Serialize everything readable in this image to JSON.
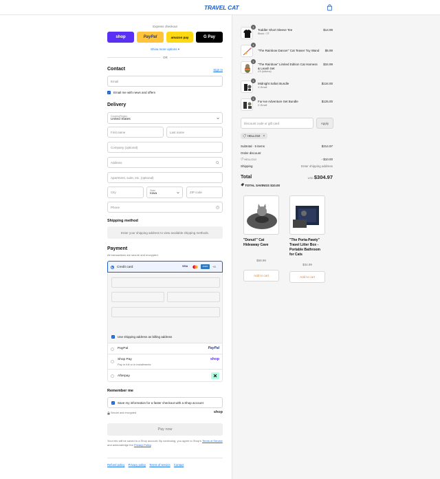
{
  "header": {
    "logo": "TRAVEL CAT"
  },
  "express": {
    "title": "Express checkout",
    "buttons": [
      {
        "label": "shop",
        "bg": "#5a31f4",
        "color": "#ffffff"
      },
      {
        "label": "PayPal",
        "bg": "#ffc439",
        "color": "#253b80"
      },
      {
        "label": "amazon pay",
        "bg": "#ffd814",
        "color": "#111111"
      },
      {
        "label": "G Pay",
        "bg": "#000000",
        "color": "#ffffff"
      }
    ],
    "more_options": "Show more options ▾",
    "or": "OR"
  },
  "contact": {
    "title": "Contact",
    "sign_in": "Sign in",
    "email_placeholder": "Email",
    "news_label": "Email me with news and offers"
  },
  "delivery": {
    "title": "Delivery",
    "country_label": "Country/Region",
    "country_value": "United States",
    "first_name": "First name",
    "last_name": "Last name",
    "company": "Company (optional)",
    "address": "Address",
    "apartment": "Apartment, suite, etc. (optional)",
    "city": "City",
    "state_label": "State",
    "state_value": "Iowa",
    "zip": "ZIP code",
    "phone": "Phone"
  },
  "shipping": {
    "title": "Shipping method",
    "message": "Enter your shipping address to view available shipping methods."
  },
  "payment": {
    "title": "Payment",
    "subtitle": "All transactions are secure and encrypted.",
    "credit_card": "Credit card",
    "card_brands": [
      "VISA",
      "MC",
      "AMEX",
      "+3"
    ],
    "billing_label": "Use shipping address as billing address",
    "paypal": "PayPal",
    "paypal_logo": "PayPal",
    "shop_pay": "Shop Pay",
    "shop_pay_sub": "Pay in full or in installments",
    "shop_logo": "shop",
    "afterpay": "Afterpay"
  },
  "remember": {
    "title": "Remember me",
    "label": "Save my information for a faster checkout with a Shop account",
    "secure": "Secure and encrypted",
    "shop_logo": "shop"
  },
  "pay_now": "Pay now",
  "legal": {
    "text": "Your info will be saved to a Shop account. By continuing, you agree to Shop's",
    "terms": "Terms of Service",
    "and": "and acknowledge the",
    "privacy": "Privacy Policy",
    "end": "."
  },
  "footer_links": [
    "Refund policy",
    "Privacy policy",
    "Terms of service",
    "Contact"
  ],
  "order": {
    "items": [
      {
        "name": "Toddler Short Sleeve Tee",
        "variant": "Black / 2T",
        "price": "$14.99",
        "qty": "1"
      },
      {
        "name": "\"The Rainbow Dancer\" Cat Teaser Toy Wand",
        "variant": "",
        "price": "$5.99",
        "qty": "1"
      },
      {
        "name": "\"The Rainbow\" Limited Edition Cat Harness & Leash Set",
        "variant": "XS (kittens)",
        "price": "$34.99",
        "qty": "1"
      },
      {
        "name": "Midnight Safari Bundle",
        "variant": "X-Small",
        "price": "$134.00",
        "qty": "1"
      },
      {
        "name": "Fur-ive Adventure Set Bundle",
        "variant": "X-Small",
        "price": "$125.00",
        "qty": "1"
      }
    ],
    "discount_placeholder": "Discount code or gift card",
    "apply": "Apply",
    "code_tag": "HELLO10",
    "subtotal_label": "Subtotal · 5 items",
    "subtotal": "$314.97",
    "order_discount_label": "Order discount",
    "discount_code": "HELLO10",
    "discount_value": "- $10.00",
    "shipping_label": "Shipping",
    "shipping_value": "Enter shipping address",
    "total_label": "Total",
    "currency": "USD",
    "total": "$304.97",
    "savings_label": "TOTAL SAVINGS",
    "savings": "$10.00"
  },
  "recommendations": [
    {
      "name": "\"Donut!\" Cat Hideaway Cave",
      "price": "$59.99",
      "button": "Add to cart"
    },
    {
      "name": "\"The Porta-Pawty\" Travel Litter Box - Portable Bathroom for Cats",
      "price": "$34.99",
      "button": "Add to cart"
    }
  ]
}
